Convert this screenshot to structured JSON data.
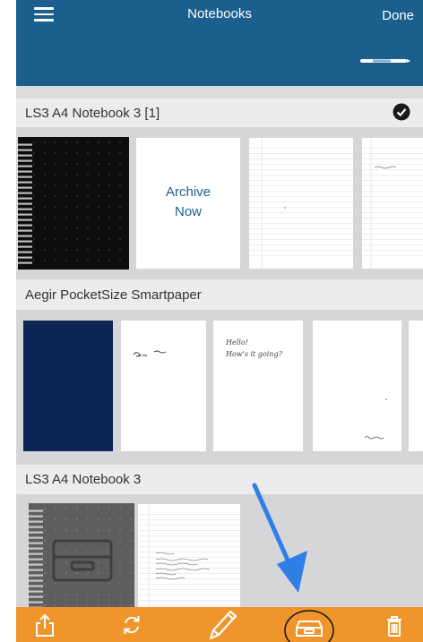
{
  "header": {
    "title": "Notebooks",
    "done_label": "Done"
  },
  "notebooks": [
    {
      "name": "LS3 A4 Notebook 3 [1]",
      "selected": true,
      "archive_label_line1": "Archive",
      "archive_label_line2": "Now"
    },
    {
      "name": "Aegir PocketSize Smartpaper",
      "page_texts": [
        "Hello!",
        "How's it going?"
      ]
    },
    {
      "name": "LS3 A4 Notebook 3"
    }
  ],
  "toolbar": [
    "share-icon",
    "sync-icon",
    "pen-edit-icon",
    "archive-tray-icon",
    "trash-icon"
  ],
  "colors": {
    "header": "#1b5f8e",
    "toolbar": "#f0952b",
    "annotation": "#2f7fe6"
  }
}
